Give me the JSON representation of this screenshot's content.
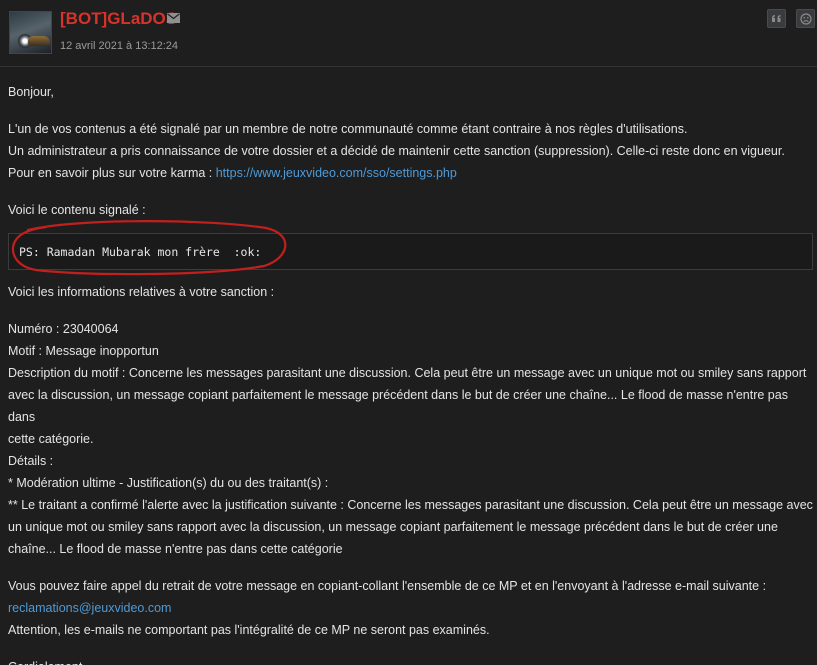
{
  "header": {
    "username": "[BOT]GLaDOS",
    "date": "12 avril 2021 à 13:12:24",
    "icons": {
      "avatar": "glados-avatar",
      "mail": "envelope-icon",
      "quote": "quote-icon",
      "alert": "alert-icon"
    },
    "colors": {
      "username": "#d8332a",
      "link": "#4f9ad6",
      "annotation": "#c0201e"
    }
  },
  "message": {
    "greeting": "Bonjour,",
    "intro_1": "L'un de vos contenus a été signalé par un membre de notre communauté comme étant contraire à nos règles d'utilisations.",
    "intro_2": "Un administrateur a pris connaissance de votre dossier et a décidé de maintenir cette sanction (suppression). Celle-ci reste donc en vigueur.",
    "karma_prefix": "Pour en savoir plus sur votre karma : ",
    "karma_link": "https://www.jeuxvideo.com/sso/settings.php",
    "reported_label": "Voici le contenu signalé :",
    "reported_content": "PS: Ramadan Mubarak mon frère  :ok:",
    "sanction_label": "Voici les informations relatives à votre sanction :",
    "numero": "Numéro : 23040064",
    "motif": "Motif : Message inopportun",
    "description_1": "Description du motif : Concerne les messages parasitant une discussion. Cela peut être un message avec un unique mot ou smiley sans rapport",
    "description_2": "avec la discussion, un message copiant parfaitement le message précédent dans le but de créer une chaîne... Le flood de masse n'entre pas dans",
    "description_3": "cette catégorie.",
    "details": "Détails :",
    "moderation": "* Modération ultime - Justification(s) du ou des traitant(s) :",
    "traitant_1": "** Le traitant a confirmé l'alerte avec la justification suivante : Concerne les messages parasitant une discussion. Cela peut être un message avec",
    "traitant_2": "un unique mot ou smiley sans rapport avec la discussion, un message copiant parfaitement le message précédent dans le but de créer une",
    "traitant_3": "chaîne... Le flood de masse n'entre pas dans cette catégorie",
    "appeal_1": "Vous pouvez faire appel du retrait de votre message en copiant-collant l'ensemble de ce MP et en l'envoyant à l'adresse e-mail suivante :",
    "appeal_email": "reclamations@jeuxvideo.com",
    "appeal_2": "Attention, les e-mails ne comportant pas l'intégralité de ce MP ne seront pas examinés.",
    "closing": "Cordialement."
  }
}
